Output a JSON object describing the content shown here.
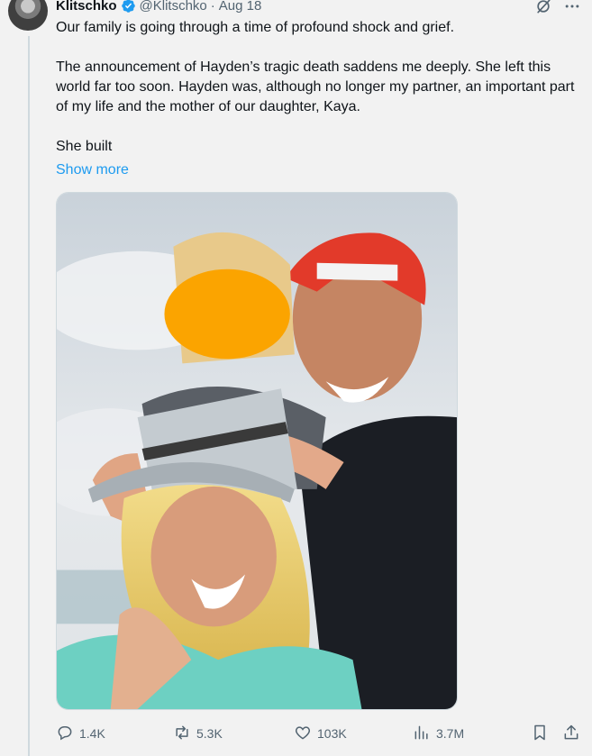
{
  "tweet": {
    "display_name": "Klitschko",
    "handle": "@Klitschko",
    "separator": "·",
    "date": "Aug 18",
    "text": [
      "Our family is going through a time of profound shock and grief.",
      "The announcement of Hayden’s tragic death saddens me deeply. She left this world far too soon. Hayden was, although no longer my partner, an important part of my life and the mother of our daughter, Kaya.",
      "She built"
    ],
    "show_more": "Show more"
  },
  "metrics": {
    "replies": "1.4K",
    "reposts": "5.3K",
    "likes": "103K",
    "views": "3.7M"
  },
  "icons": {
    "verified": "verified-badge-icon",
    "grok": "grok-icon",
    "more": "more-icon",
    "reply": "reply-icon",
    "repost": "repost-icon",
    "like": "heart-icon",
    "views": "views-icon",
    "bookmark": "bookmark-icon",
    "share": "share-icon"
  },
  "colors": {
    "accent": "#1d9bf0",
    "text": "#0f1419",
    "muted": "#536471",
    "background": "#f2f2f2"
  }
}
